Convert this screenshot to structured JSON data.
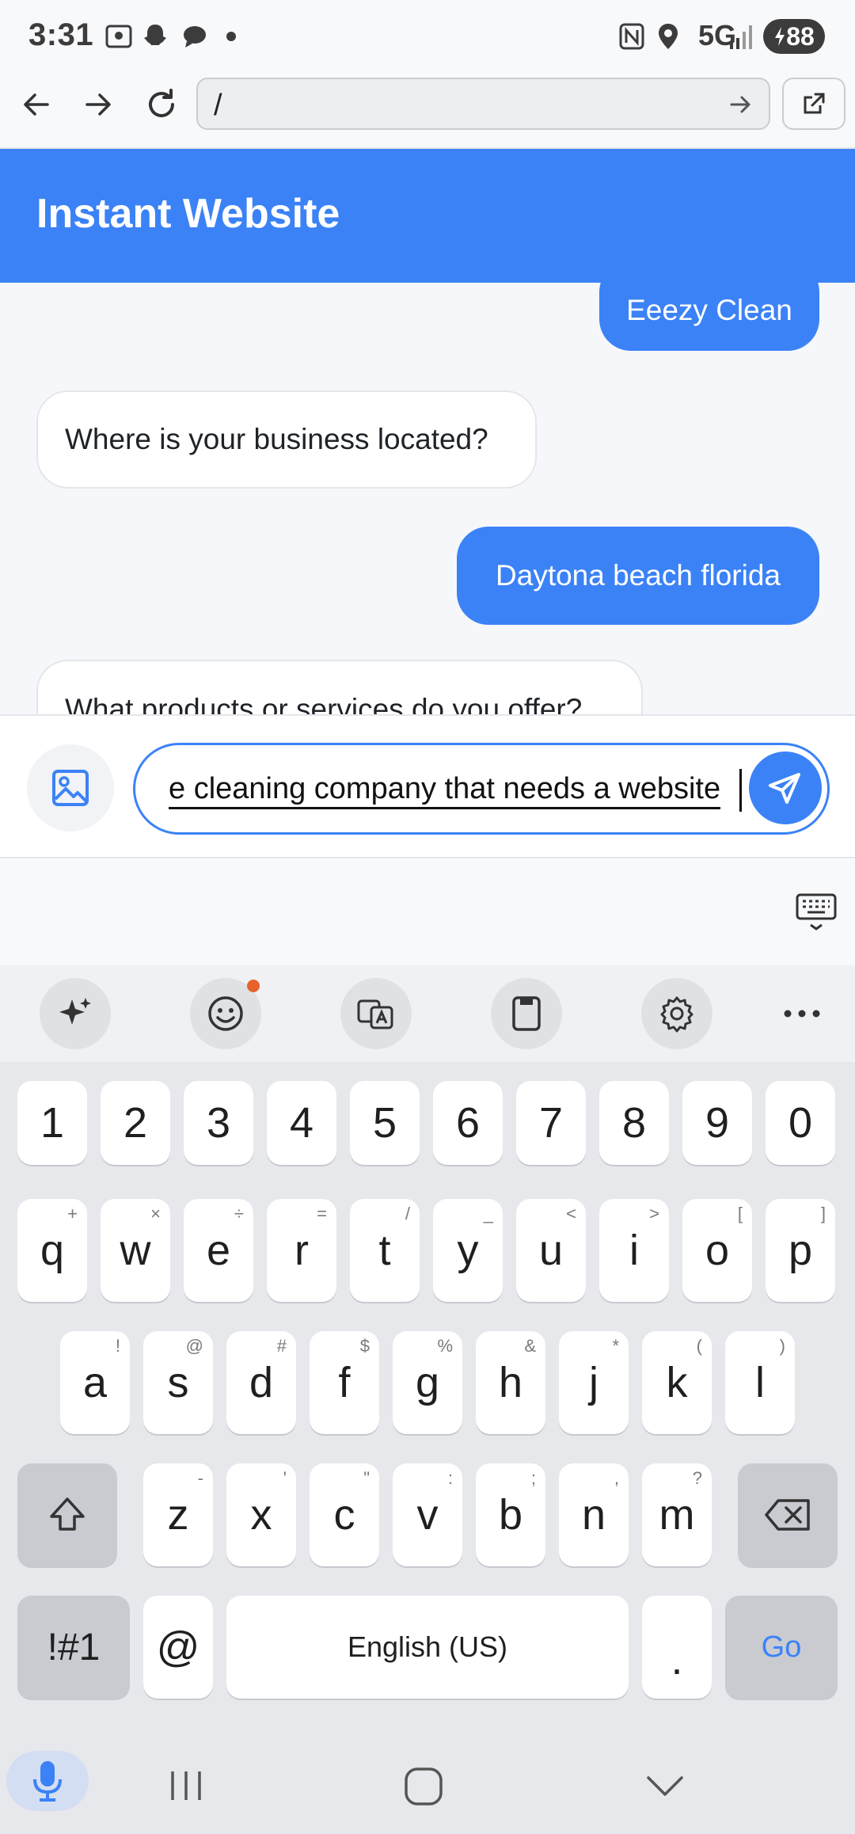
{
  "status_bar": {
    "time": "3:31",
    "network": "5G",
    "battery": "88"
  },
  "browser": {
    "url": "/"
  },
  "app": {
    "title": "Instant Website"
  },
  "chat": {
    "messages": [
      {
        "role": "user",
        "text": "Eeezy Clean"
      },
      {
        "role": "bot",
        "text": "Where is your business located?"
      },
      {
        "role": "user",
        "text": "Daytona beach florida"
      },
      {
        "role": "bot",
        "text": "What products or services do you offer?"
      }
    ]
  },
  "composer": {
    "value": "e cleaning company that needs a website"
  },
  "keyboard": {
    "numbers": [
      "1",
      "2",
      "3",
      "4",
      "5",
      "6",
      "7",
      "8",
      "9",
      "0"
    ],
    "row1": [
      {
        "k": "q",
        "s": "+"
      },
      {
        "k": "w",
        "s": "×"
      },
      {
        "k": "e",
        "s": "÷"
      },
      {
        "k": "r",
        "s": "="
      },
      {
        "k": "t",
        "s": "/"
      },
      {
        "k": "y",
        "s": "_"
      },
      {
        "k": "u",
        "s": "<"
      },
      {
        "k": "i",
        "s": ">"
      },
      {
        "k": "o",
        "s": "["
      },
      {
        "k": "p",
        "s": "]"
      }
    ],
    "row2": [
      {
        "k": "a",
        "s": "!"
      },
      {
        "k": "s",
        "s": "@"
      },
      {
        "k": "d",
        "s": "#"
      },
      {
        "k": "f",
        "s": "$"
      },
      {
        "k": "g",
        "s": "%"
      },
      {
        "k": "h",
        "s": "&"
      },
      {
        "k": "j",
        "s": "*"
      },
      {
        "k": "k",
        "s": "("
      },
      {
        "k": "l",
        "s": ")"
      }
    ],
    "row3": [
      {
        "k": "z",
        "s": "-"
      },
      {
        "k": "x",
        "s": "'"
      },
      {
        "k": "c",
        "s": "\""
      },
      {
        "k": "v",
        "s": ":"
      },
      {
        "k": "b",
        "s": ";"
      },
      {
        "k": "n",
        "s": ","
      },
      {
        "k": "m",
        "s": "?"
      }
    ],
    "symbols_label": "!#1",
    "at_label": "@",
    "space_label": "English (US)",
    "period_label": ".",
    "go_label": "Go"
  }
}
